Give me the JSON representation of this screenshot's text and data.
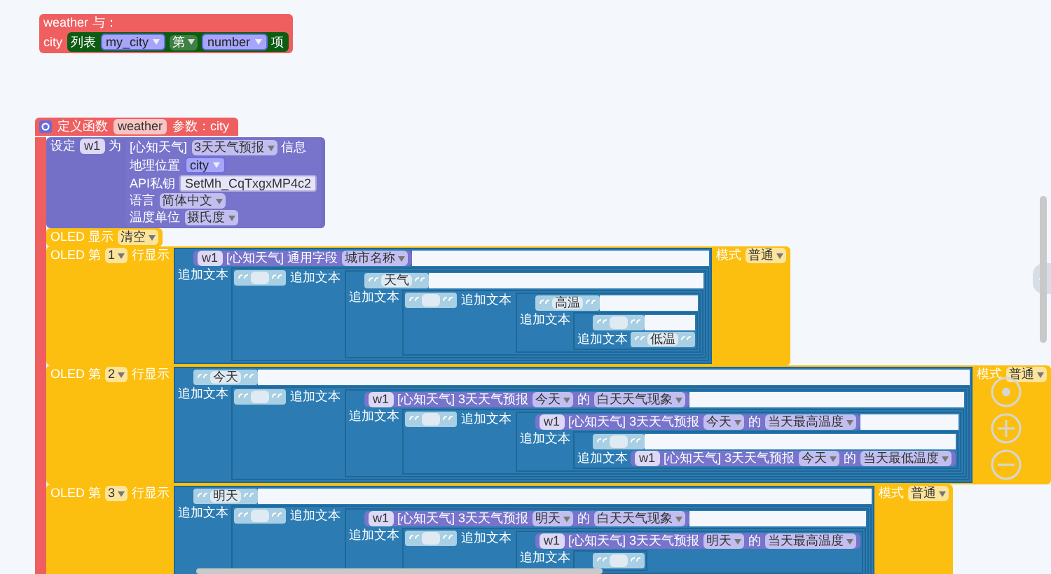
{
  "blocks": [
    {
      "kind": "hat",
      "rows": [
        [
          {
            "kind": "label",
            "text": "weather"
          },
          {
            "kind": "label",
            "text": "与："
          }
        ],
        [
          {
            "kind": "label",
            "text": "city"
          },
          {
            "kind": "input",
            "block": {
              "kind": "list",
              "rows": [
                [
                  {
                    "kind": "label",
                    "text": "列表"
                  },
                  {
                    "kind": "input",
                    "block": {
                      "kind": "variable",
                      "text": "my_city"
                    }
                  },
                  {
                    "kind": "dropdown",
                    "text": "第"
                  },
                  {
                    "kind": "input",
                    "block": {
                      "kind": "variable",
                      "text": "number"
                    }
                  },
                  {
                    "kind": "label",
                    "text": "项"
                  }
                ]
              ]
            }
          }
        ]
      ]
    },
    {
      "kind": "procedure",
      "rows": [
        [
          {
            "kind": "label",
            "text": "定义函数"
          },
          {
            "kind": "chip",
            "text": "weather"
          },
          {
            "kind": "label",
            "text": "参数：city"
          }
        ]
      ],
      "statements": [
        {
          "kind": "set",
          "rows": [
            [
              {
                "kind": "label",
                "text": "设定"
              },
              {
                "kind": "chip",
                "text": "w1"
              },
              {
                "kind": "label",
                "text": "为"
              },
              {
                "kind": "input",
                "block": {
                  "kind": "weather",
                  "rows": [
                    [
                      {
                        "kind": "label",
                        "text": "[心知天气]"
                      },
                      {
                        "kind": "dropdown",
                        "text": "3天天气预报"
                      },
                      {
                        "kind": "label",
                        "text": "信息"
                      }
                    ],
                    [
                      {
                        "kind": "label",
                        "text": "地理位置"
                      },
                      {
                        "kind": "input",
                        "block": {
                          "kind": "variable",
                          "text": "city"
                        }
                      }
                    ],
                    [
                      {
                        "kind": "label",
                        "text": "API私钥"
                      },
                      {
                        "kind": "field",
                        "text": "SetMh_CqTxgxMP4c2"
                      }
                    ],
                    [
                      {
                        "kind": "label",
                        "text": "语言"
                      },
                      {
                        "kind": "dropdown",
                        "text": "简体中文"
                      }
                    ],
                    [
                      {
                        "kind": "label",
                        "text": "温度单位"
                      },
                      {
                        "kind": "dropdown",
                        "text": "摄氏度"
                      }
                    ]
                  ]
                }
              }
            ]
          ]
        },
        {
          "kind": "oled",
          "rows": [
            [
              {
                "kind": "label",
                "text": "OLED 显示"
              },
              {
                "kind": "dropdown",
                "text": "清空"
              }
            ]
          ]
        },
        {
          "kind": "oled",
          "rows": [
            [
              {
                "kind": "label",
                "text": "OLED 第"
              },
              {
                "kind": "dropdown",
                "text": "1"
              },
              {
                "kind": "label",
                "text": "行显示"
              },
              {
                "kind": "input",
                "block": {
                  "kind": "join",
                  "inline": false,
                  "label": "追加文本",
                  "inputs": [
                    {
                      "kind": "weather",
                      "rows": [
                        [
                          {
                            "kind": "chip",
                            "text": "w1"
                          },
                          {
                            "kind": "label",
                            "text": "[心知天气] 通用字段"
                          },
                          {
                            "kind": "dropdown",
                            "text": "城市名称"
                          }
                        ]
                      ]
                    },
                    {
                      "kind": "join",
                      "inline": true,
                      "label": "追加文本",
                      "inputs": [
                        {
                          "kind": "string"
                        },
                        {
                          "kind": "join",
                          "inline": false,
                          "label": "追加文本",
                          "inputs": [
                            {
                              "kind": "string",
                              "value": "天气"
                            },
                            {
                              "kind": "join",
                              "inline": true,
                              "label": "追加文本",
                              "inputs": [
                                {
                                  "kind": "string"
                                },
                                {
                                  "kind": "join",
                                  "inline": false,
                                  "label": "追加文本",
                                  "inputs": [
                                    {
                                      "kind": "string",
                                      "value": "高温"
                                    },
                                    {
                                      "kind": "join",
                                      "inline": false,
                                      "label": "追加文本",
                                      "inputs": [
                                        {
                                          "kind": "string"
                                        },
                                        {
                                          "kind": "string",
                                          "value": "低温"
                                        }
                                      ]
                                    }
                                  ]
                                }
                              ]
                            }
                          ]
                        }
                      ]
                    }
                  ]
                }
              },
              {
                "kind": "label",
                "text": "模式"
              },
              {
                "kind": "dropdown",
                "text": "普通"
              }
            ]
          ]
        },
        {
          "kind": "oled",
          "rows": [
            [
              {
                "kind": "label",
                "text": "OLED 第"
              },
              {
                "kind": "dropdown",
                "text": "2"
              },
              {
                "kind": "label",
                "text": "行显示"
              },
              {
                "kind": "input",
                "block": {
                  "kind": "join",
                  "inline": false,
                  "label": "追加文本",
                  "inputs": [
                    {
                      "kind": "string",
                      "value": "今天"
                    },
                    {
                      "kind": "join",
                      "inline": true,
                      "label": "追加文本",
                      "inputs": [
                        {
                          "kind": "string"
                        },
                        {
                          "kind": "join",
                          "inline": false,
                          "label": "追加文本",
                          "inputs": [
                            {
                              "kind": "weather",
                              "rows": [
                                [
                                  {
                                    "kind": "chip",
                                    "text": "w1"
                                  },
                                  {
                                    "kind": "label",
                                    "text": "[心知天气] 3天天气预报"
                                  },
                                  {
                                    "kind": "dropdown",
                                    "text": "今天"
                                  },
                                  {
                                    "kind": "label",
                                    "text": "的"
                                  },
                                  {
                                    "kind": "dropdown",
                                    "text": "白天天气现象"
                                  }
                                ]
                              ]
                            },
                            {
                              "kind": "join",
                              "inline": true,
                              "label": "追加文本",
                              "inputs": [
                                {
                                  "kind": "string"
                                },
                                {
                                  "kind": "join",
                                  "inline": false,
                                  "label": "追加文本",
                                  "inputs": [
                                    {
                                      "kind": "weather",
                                      "rows": [
                                        [
                                          {
                                            "kind": "chip",
                                            "text": "w1"
                                          },
                                          {
                                            "kind": "label",
                                            "text": "[心知天气] 3天天气预报"
                                          },
                                          {
                                            "kind": "dropdown",
                                            "text": "今天"
                                          },
                                          {
                                            "kind": "label",
                                            "text": "的"
                                          },
                                          {
                                            "kind": "dropdown",
                                            "text": "当天最高温度"
                                          }
                                        ]
                                      ]
                                    },
                                    {
                                      "kind": "join",
                                      "inline": false,
                                      "label": "追加文本",
                                      "inputs": [
                                        {
                                          "kind": "string"
                                        },
                                        {
                                          "kind": "weather",
                                          "rows": [
                                            [
                                              {
                                                "kind": "chip",
                                                "text": "w1"
                                              },
                                              {
                                                "kind": "label",
                                                "text": "[心知天气] 3天天气预报"
                                              },
                                              {
                                                "kind": "dropdown",
                                                "text": "今天"
                                              },
                                              {
                                                "kind": "label",
                                                "text": "的"
                                              },
                                              {
                                                "kind": "dropdown",
                                                "text": "当天最低温度"
                                              }
                                            ]
                                          ]
                                        }
                                      ]
                                    }
                                  ]
                                }
                              ]
                            }
                          ]
                        }
                      ]
                    }
                  ]
                }
              },
              {
                "kind": "label",
                "text": "模式"
              },
              {
                "kind": "dropdown",
                "text": "普通"
              }
            ]
          ]
        },
        {
          "kind": "oled",
          "rows": [
            [
              {
                "kind": "label",
                "text": "OLED 第"
              },
              {
                "kind": "dropdown",
                "text": "3"
              },
              {
                "kind": "label",
                "text": "行显示"
              },
              {
                "kind": "input",
                "block": {
                  "kind": "join",
                  "inline": false,
                  "label": "追加文本",
                  "inputs": [
                    {
                      "kind": "string",
                      "value": "明天"
                    },
                    {
                      "kind": "join",
                      "inline": true,
                      "label": "追加文本",
                      "inputs": [
                        {
                          "kind": "string"
                        },
                        {
                          "kind": "join",
                          "inline": false,
                          "label": "追加文本",
                          "inputs": [
                            {
                              "kind": "weather",
                              "rows": [
                                [
                                  {
                                    "kind": "chip",
                                    "text": "w1"
                                  },
                                  {
                                    "kind": "label",
                                    "text": "[心知天气] 3天天气预报"
                                  },
                                  {
                                    "kind": "dropdown",
                                    "text": "明天"
                                  },
                                  {
                                    "kind": "label",
                                    "text": "的"
                                  },
                                  {
                                    "kind": "dropdown",
                                    "text": "白天天气现象"
                                  }
                                ]
                              ]
                            },
                            {
                              "kind": "join",
                              "inline": true,
                              "label": "追加文本",
                              "inputs": [
                                {
                                  "kind": "string"
                                },
                                {
                                  "kind": "join",
                                  "inline": false,
                                  "label": "追加文本",
                                  "inputs": [
                                    {
                                      "kind": "weather",
                                      "rows": [
                                        [
                                          {
                                            "kind": "chip",
                                            "text": "w1"
                                          },
                                          {
                                            "kind": "label",
                                            "text": "[心知天气] 3天天气预报"
                                          },
                                          {
                                            "kind": "dropdown",
                                            "text": "明天"
                                          },
                                          {
                                            "kind": "label",
                                            "text": "的"
                                          },
                                          {
                                            "kind": "dropdown",
                                            "text": "当天最高温度"
                                          }
                                        ]
                                      ]
                                    },
                                    {
                                      "kind": "join",
                                      "inline": false,
                                      "inputs": [
                                        {
                                          "kind": "string"
                                        }
                                      ]
                                    }
                                  ]
                                }
                              ]
                            }
                          ]
                        }
                      ]
                    }
                  ]
                }
              },
              {
                "kind": "label",
                "text": "模式"
              },
              {
                "kind": "dropdown",
                "text": "普通"
              }
            ]
          ]
        }
      ]
    }
  ]
}
